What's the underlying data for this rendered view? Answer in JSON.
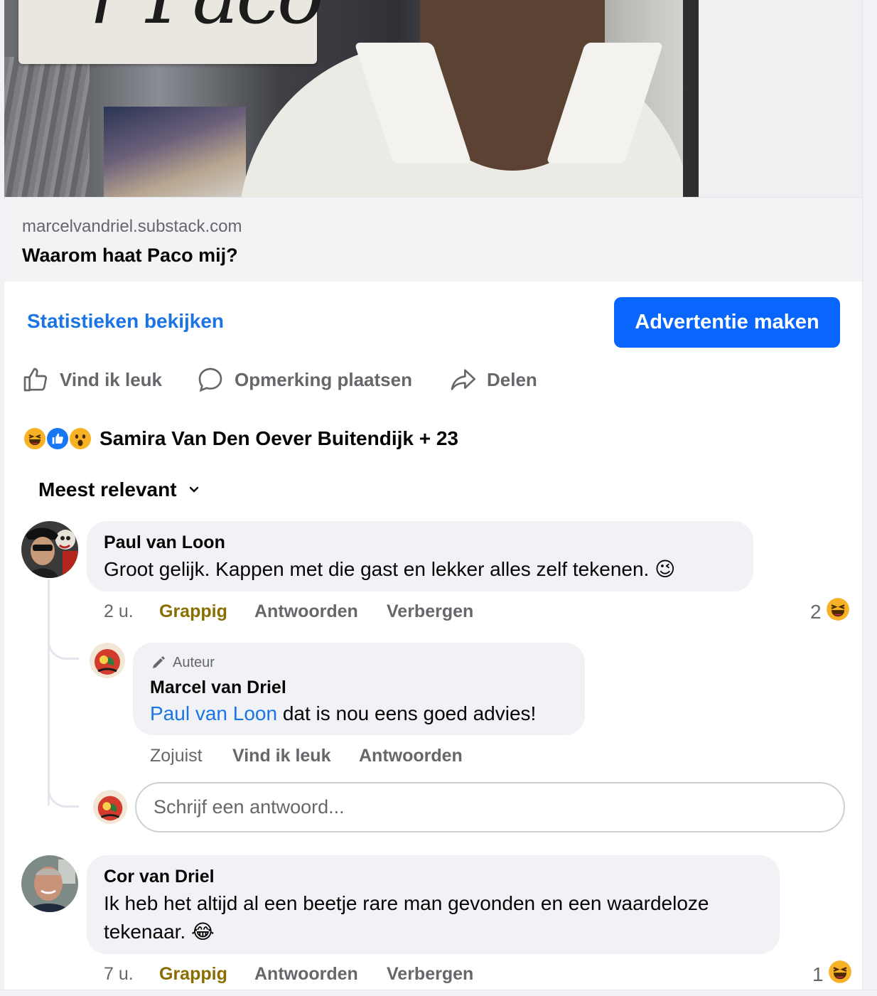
{
  "link_preview": {
    "domain": "marcelvandriel.substack.com",
    "title": "Waarom haat Paco mij?"
  },
  "post_actions": {
    "stats_link": "Statistieken bekijken",
    "ad_button": "Advertentie maken",
    "like": "Vind ik leuk",
    "comment": "Opmerking plaatsen",
    "share": "Delen"
  },
  "reactions": {
    "icons": [
      "haha-reaction-icon",
      "like-reaction-icon",
      "wow-reaction-icon"
    ],
    "summary": "Samira Van Den Oever Buitendijk + 23"
  },
  "sort": {
    "label": "Meest relevant"
  },
  "comments": [
    {
      "author": "Paul van Loon",
      "text": "Groot gelijk. Kappen met die gast en lekker alles zelf tekenen. 😉",
      "time": "2 u.",
      "reaction_label": "Grappig",
      "reply": "Antwoorden",
      "hide": "Verbergen",
      "reaction_count": "2",
      "reaction_icon": "haha-reaction-icon",
      "replies": [
        {
          "badge": "Auteur",
          "author": "Marcel van Driel",
          "mention": "Paul van Loon",
          "text": " dat is nou eens goed advies!",
          "time": "Zojuist",
          "like": "Vind ik leuk",
          "reply": "Antwoorden"
        }
      ]
    },
    {
      "author": "Cor van Driel",
      "text": "Ik heb het altijd al een beetje rare man gevonden en een waardeloze tekenaar. 😂",
      "time": "7 u.",
      "reaction_label": "Grappig",
      "reply": "Antwoorden",
      "hide": "Verbergen",
      "reaction_count": "1",
      "reaction_icon": "haha-reaction-icon"
    }
  ],
  "reply_input": {
    "placeholder": "Schrijf een antwoord..."
  },
  "colors": {
    "accent": "#0866ff",
    "link": "#1b74e4",
    "funny": "#8a6d00",
    "bubble": "#f0f2f5"
  }
}
